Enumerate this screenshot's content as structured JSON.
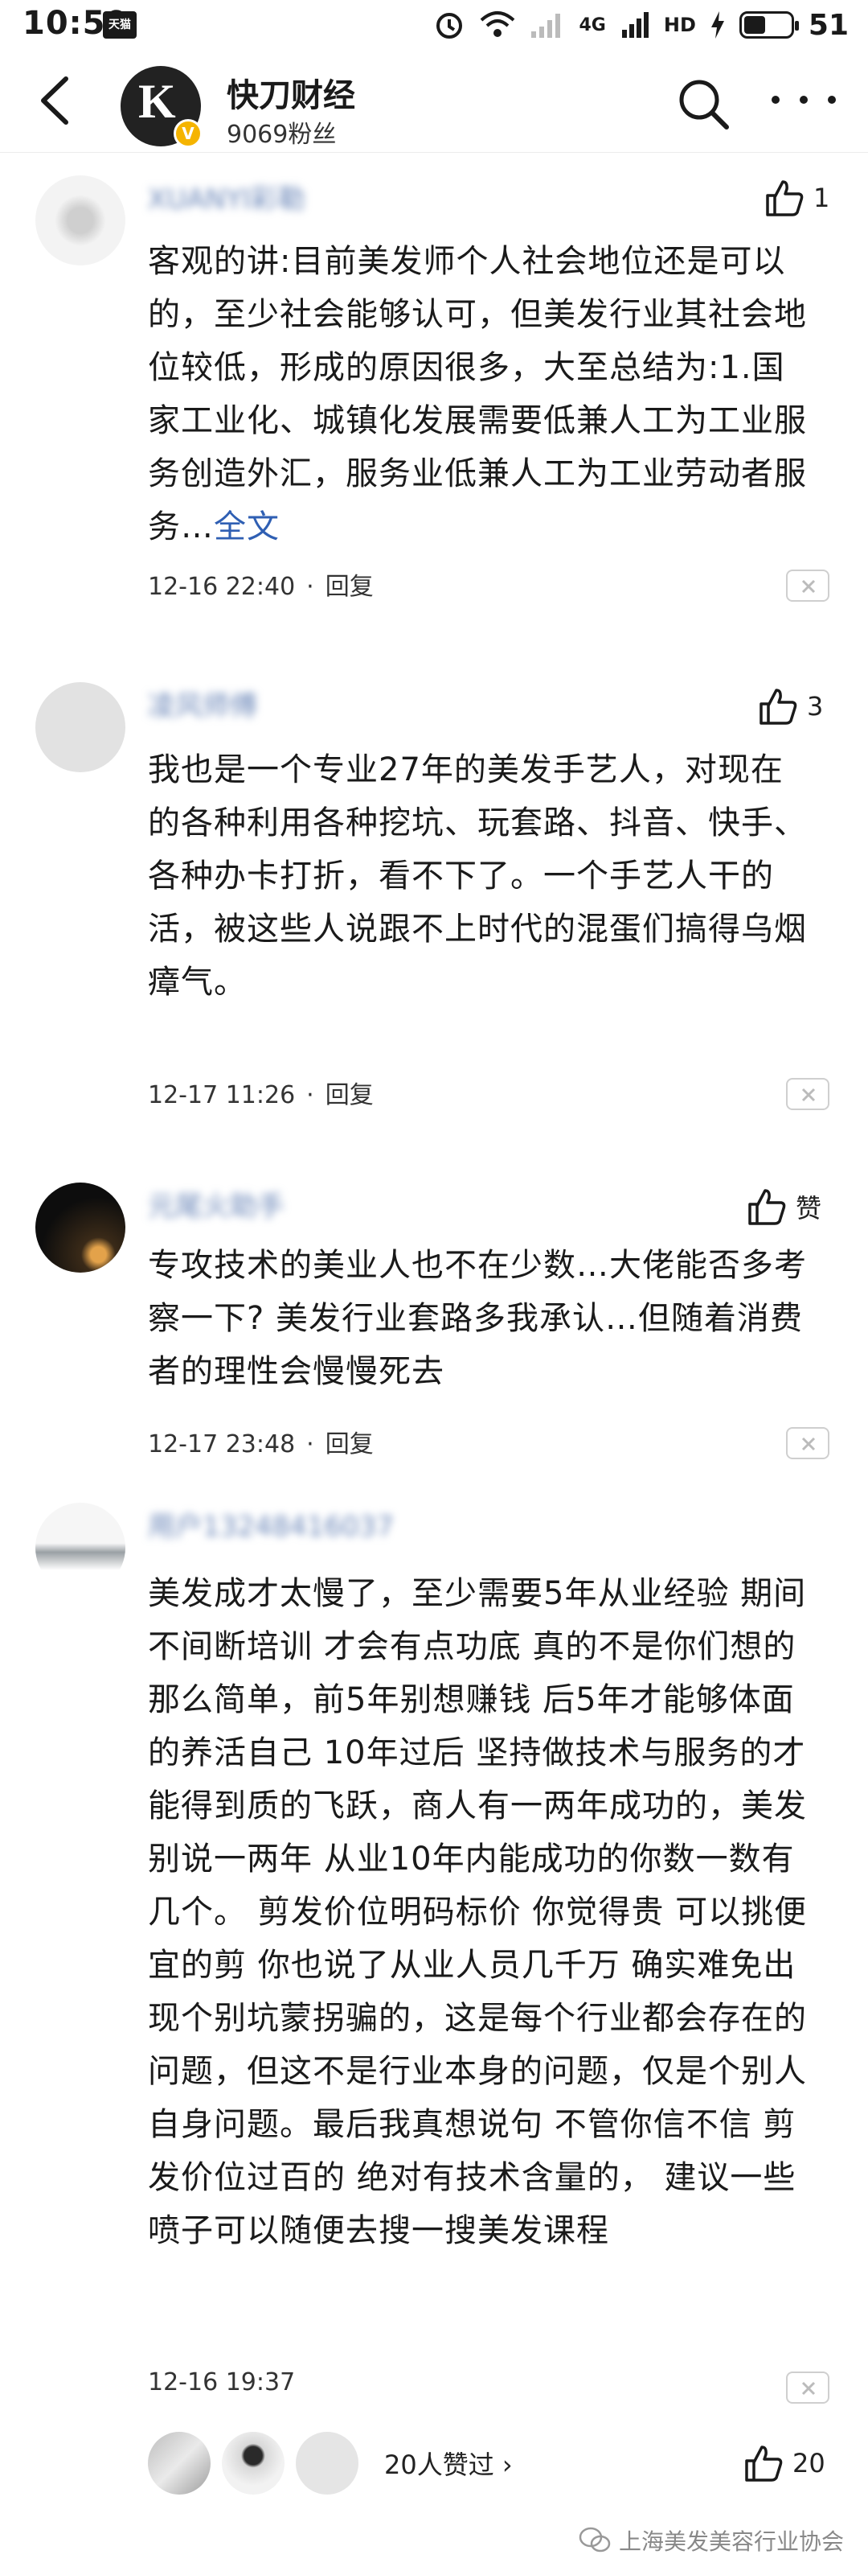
{
  "status_bar": {
    "time": "10:59",
    "chip": "天猫",
    "network": "4G",
    "hd": "HD",
    "battery": "51"
  },
  "header": {
    "name": "快刀财经",
    "fans": "9069粉丝",
    "avatar_letter": "K",
    "verified_mark": "V"
  },
  "comments": [
    {
      "username": "XUANYI彩勒",
      "likes": "1",
      "text": "客观的讲:目前美发师个人社会地位还是可以的，至少社会能够认可，但美发行业其社会地位较低，形成的原因很多，大至总结为:1.国家工业化、城镇化发展需要低兼人工为工业服务创造外汇，服务业低兼人工为工业劳动者服务…",
      "more_label": "全文",
      "time": "12-16 22:40",
      "reply_label": "回复"
    },
    {
      "username": "凌风师傅",
      "likes": "3",
      "text": "我也是一个专业27年的美发手艺人，对现在的各种利用各种挖坑、玩套路、抖音、快手、各种办卡打折，看不下了。一个手艺人干的活，被这些人说跟不上时代的混蛋们搞得乌烟瘴气。",
      "time": "12-17 11:26",
      "reply_label": "回复"
    },
    {
      "username": "元尾火助手",
      "likes": "赞",
      "text": "专攻技术的美业人也不在少数…大佬能否多考察一下? 美发行业套路多我承认…但随着消费者的理性会慢慢死去",
      "time": "12-17 23:48",
      "reply_label": "回复"
    },
    {
      "username": "用户13248416037",
      "likes": "20",
      "text": "美发成才太慢了，至少需要5年从业经验 期间不间断培训 才会有点功底 真的不是你们想的那么简单，前5年别想赚钱 后5年才能够体面的养活自己 10年过后 坚持做技术与服务的才能得到质的飞跃，商人有一两年成功的，美发别说一两年 从业10年内能成功的你数一数有几个。 剪发价位明码标价 你觉得贵 可以挑便宜的剪 你也说了从业人员几千万 确实难免出现个别坑蒙拐骗的，这是每个行业都会存在的问题，但这不是行业本身的问题，仅是个别人自身问题。最后我真想说句 不管你信不信 剪发价位过百的 绝对有技术含量的， 建议一些喷子可以随便去搜一搜美发课程",
      "time": "12-16 19:37",
      "likers_label": "20人赞过 ›"
    }
  ],
  "watermark": "上海美发美容行业协会",
  "colors": {
    "link": "#2f5fb3",
    "username": "#6a86b8"
  },
  "icons": [
    "back-arrow-icon",
    "search-icon",
    "more-icon",
    "thumb-up-icon",
    "close-icon",
    "wechat-icon"
  ]
}
